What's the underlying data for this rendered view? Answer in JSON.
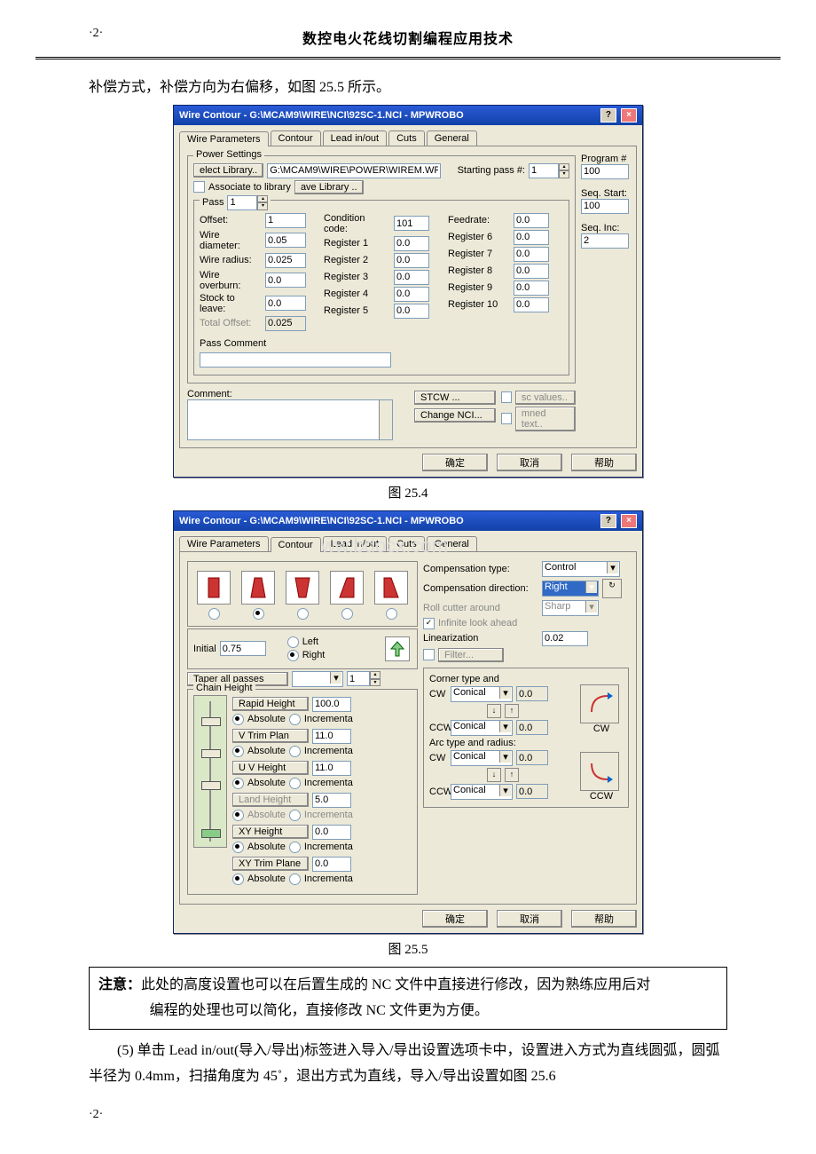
{
  "header": {
    "page_number": "·2·",
    "book_title": "数控电火花线切割编程应用技术"
  },
  "para1": "补偿方式，补偿方向为右偏移，如图 25.5 所示。",
  "fig254": "图 25.4",
  "fig255": "图 25.5",
  "note": {
    "label": "注意：",
    "line1": "此处的高度设置也可以在后置生成的 NC 文件中直接进行修改，因为熟练应用后对",
    "line2": "编程的处理也可以简化，直接修改 NC 文件更为方便。"
  },
  "para2": "(5)   单击 Lead in/out(导入/导出)标签进入导入/导出设置选项卡中，设置进入方式为直线圆弧，圆弧半径为 0.4mm，扫描角度为 45˚，退出方式为直线，导入/导出设置如图 25.6",
  "footer": {
    "page_number": "·2·"
  },
  "dlg1": {
    "title": "Wire Contour - G:\\MCAM9\\WIRE\\NCI\\92SC-1.NCI - MPWROBO",
    "tabs": [
      "Wire Parameters",
      "Contour",
      "Lead in/out",
      "Cuts",
      "General"
    ],
    "active_tab": "Wire Parameters",
    "power_legend": "Power Settings",
    "select_lib_btn": "elect Library..",
    "lib_path": "G:\\MCAM9\\WIRE\\POWER\\WIREM.WP9",
    "assoc_label": "Associate to library",
    "save_lib_btn": "ave Library ..",
    "pass_label": "Pass",
    "pass_val": "1",
    "start_pass_label": "Starting pass #:",
    "start_pass_val": "1",
    "offset_label": "Offset:",
    "offset_val": "1",
    "cond_label": "Condition code:",
    "cond_val": "101",
    "feed_label": "Feedrate:",
    "feed_val": "0.0",
    "wdia_label": "Wire diameter:",
    "wdia_val": "0.05",
    "wrad_label": "Wire radius:",
    "wrad_val": "0.025",
    "wob_label": "Wire overburn:",
    "wob_val": "0.0",
    "stl_label": "Stock to leave:",
    "stl_val": "0.0",
    "tof_label": "Total Offset:",
    "tof_val": "0.025",
    "reg_labels": [
      "Register 1",
      "Register 2",
      "Register 3",
      "Register 4",
      "Register 5"
    ],
    "reg_vals": [
      "0.0",
      "0.0",
      "0.0",
      "0.0",
      "0.0"
    ],
    "reg2_labels": [
      "Register 6",
      "Register 7",
      "Register 8",
      "Register 9",
      "Register 10"
    ],
    "reg2_vals": [
      "0.0",
      "0.0",
      "0.0",
      "0.0",
      "0.0"
    ],
    "passc_label": "Pass Comment",
    "comment_label": "Comment:",
    "stcw_btn": "STCW ...",
    "chnci_btn": "Change NCI...",
    "sc_val_chk": "sc values..",
    "mned_chk": "mned text..",
    "prog_label": "Program #",
    "prog_val": "100",
    "seqs_label": "Seq. Start:",
    "seqs_val": "100",
    "seqi_label": "Seq. Inc:",
    "seqi_val": "2",
    "ok": "确定",
    "cancel": "取消",
    "help": "帮助"
  },
  "dlg2": {
    "title": "Wire Contour - G:\\MCAM9\\WIRE\\NCI\\92SC-1.NCI - MPWROBO",
    "tabs": [
      "Wire Parameters",
      "Contour",
      "Lead in/out",
      "Cuts",
      "General"
    ],
    "active_tab": "Contour",
    "watermark": "www.bdocx.com",
    "initial_label": "Initial",
    "initial_val": "0.75",
    "left": "Left",
    "right": "Right",
    "taper_btn": "Taper all passes",
    "taper_spin": "1",
    "chain_label": "Chain Height",
    "rows": [
      {
        "btn": "Rapid Height",
        "val": "100.0",
        "abs": "Absolute",
        "inc": "Incrementa"
      },
      {
        "btn": "V Trim Plan",
        "val": "11.0",
        "abs": "Absolute",
        "inc": "Incrementa"
      },
      {
        "btn": "U V Height",
        "val": "11.0",
        "abs": "Absolute",
        "inc": "Incrementa"
      },
      {
        "btn": "Land Height",
        "val": "5.0",
        "abs": "Absolute",
        "inc": "Incrementa",
        "dis": true
      },
      {
        "btn": "XY Height",
        "val": "0.0",
        "abs": "Absolute",
        "inc": "Incrementa"
      },
      {
        "btn": "XY Trim Plane",
        "val": "0.0",
        "abs": "Absolute",
        "inc": "Incrementa"
      }
    ],
    "comp_type_l": "Compensation type:",
    "comp_type_v": "Control",
    "comp_dir_l": "Compensation direction:",
    "comp_dir_v": "Right",
    "roll_l": "Roll cutter around",
    "roll_v": "Sharp",
    "inf_l": "Infinite look ahead",
    "lin_l": "Linearization",
    "lin_v": "0.02",
    "filter_l": "Filter...",
    "corner_l": "Corner type and",
    "arc_l": "Arc type and radius:",
    "cw": "CW",
    "ccw": "CCW",
    "conical": "Conical",
    "zero": "0.0",
    "ok": "确定",
    "cancel": "取消",
    "help": "帮助"
  }
}
